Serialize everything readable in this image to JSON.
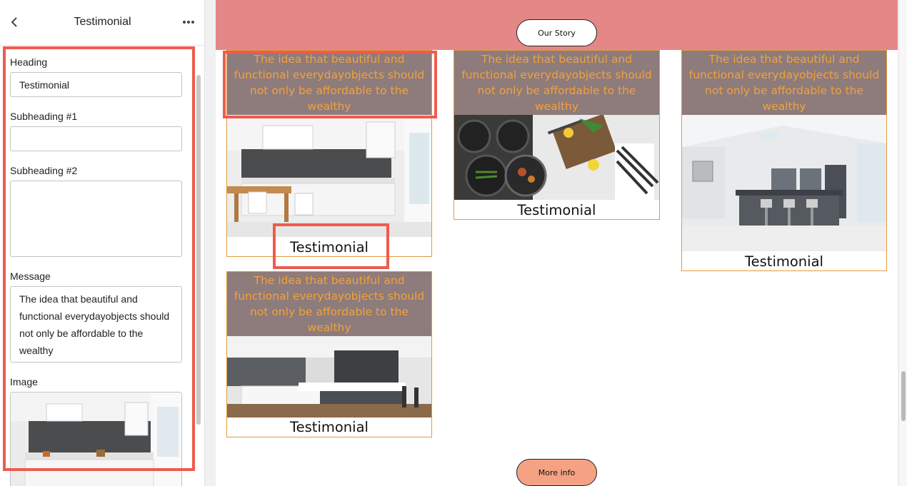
{
  "sidebar": {
    "title": "Testimonial",
    "back_icon": "chevron-left-icon",
    "more_icon": "more-horizontal-icon",
    "fields": {
      "heading": {
        "label": "Heading",
        "value": "Testimonial"
      },
      "subheading1": {
        "label": "Subheading #1",
        "value": ""
      },
      "subheading2": {
        "label": "Subheading #2",
        "value": ""
      },
      "message": {
        "label": "Message",
        "value": "The idea that beautiful and functional everydayobjects should not only be affordable to the wealthy"
      },
      "image": {
        "label": "Image"
      }
    }
  },
  "preview": {
    "banner_button": "Our Story",
    "more_button": "More info",
    "cards": [
      {
        "message": "The idea that beautiful and functional everydayobjects should not only be affordable to the wealthy",
        "title": "Testimonial"
      },
      {
        "message": "The idea that beautiful and functional everydayobjects should not only be affordable to the wealthy",
        "title": "Testimonial"
      },
      {
        "message": "The idea that beautiful and functional everydayobjects should not only be affordable to the wealthy",
        "title": "Testimonial"
      },
      {
        "message": "The idea that beautiful and functional everydayobjects should not only be affordable to the wealthy",
        "title": "Testimonial"
      }
    ]
  },
  "colors": {
    "banner": "#e48787",
    "highlight": "#ef5b4f",
    "card_border": "#e39a3c",
    "message_bg": "#8e7b7b",
    "message_text": "#f2a23a",
    "more_info_bg": "#f4a283"
  }
}
